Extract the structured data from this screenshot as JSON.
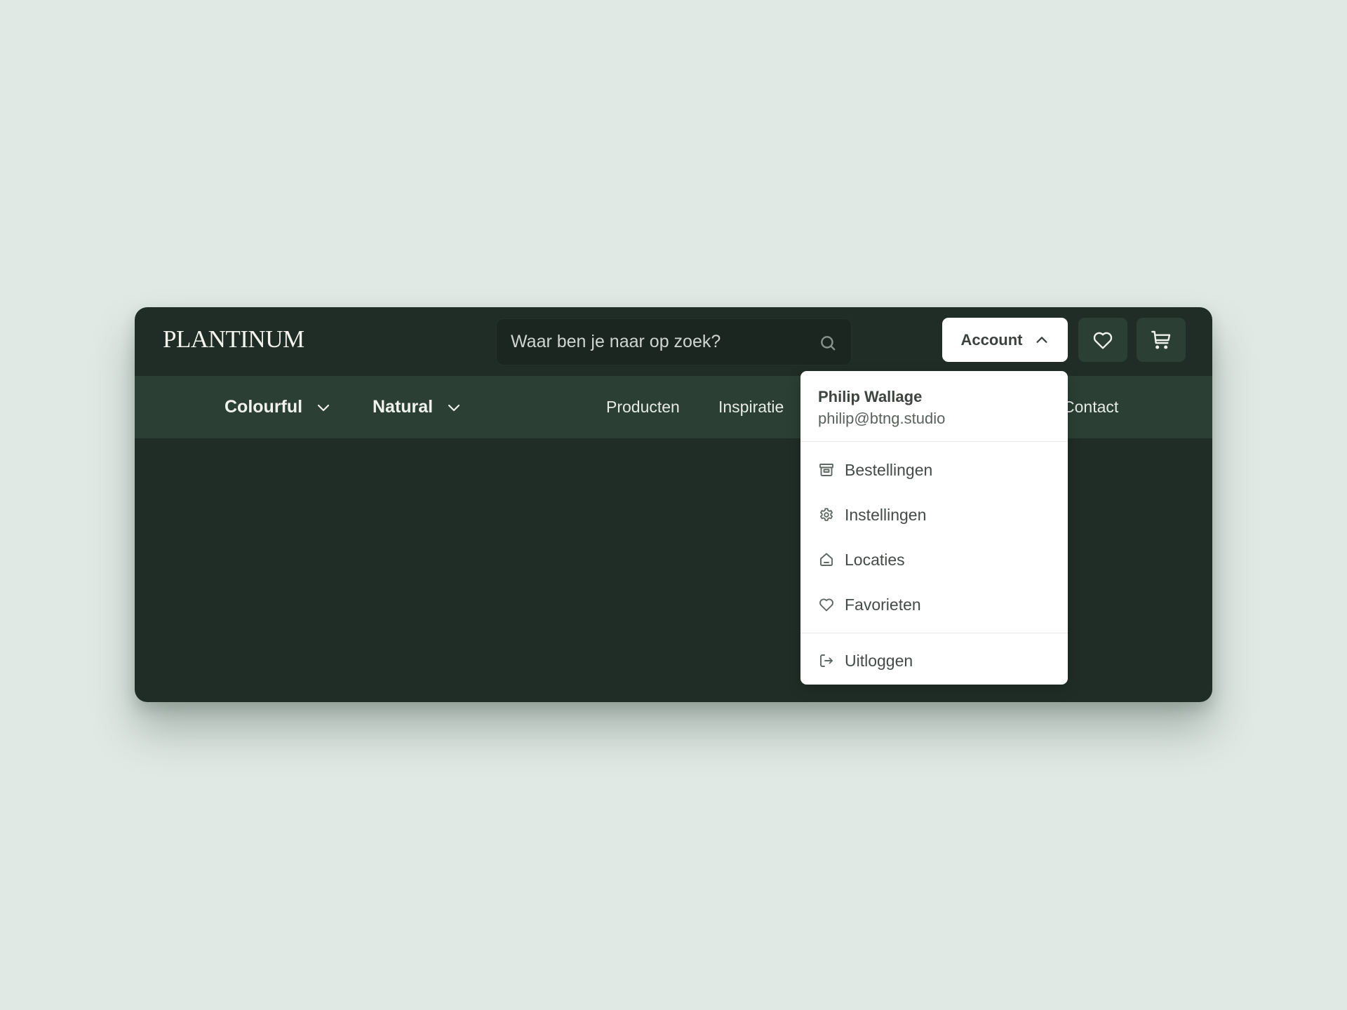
{
  "brand": {
    "logo": "PLANTINUM"
  },
  "header": {
    "search": {
      "placeholder": "Waar ben je naar op zoek?",
      "value": "",
      "icon": "search-icon"
    },
    "account_button": {
      "label": "Account",
      "icon": "chevron-up-icon",
      "expanded": true
    },
    "favorites_button": {
      "icon": "heart-icon"
    },
    "cart_button": {
      "icon": "cart-icon"
    }
  },
  "subnav": {
    "dropdown_items": [
      {
        "label": "Colourful",
        "icon": "chevron-down-icon"
      },
      {
        "label": "Natural",
        "icon": "chevron-down-icon"
      }
    ],
    "links": [
      {
        "label": "Producten"
      },
      {
        "label": "Inspiratie"
      },
      {
        "label": "Contact"
      }
    ]
  },
  "account_menu": {
    "user": {
      "name": "Philip Wallage",
      "email": "philip@btng.studio"
    },
    "items": [
      {
        "label": "Bestellingen",
        "icon": "archive-icon"
      },
      {
        "label": "Instellingen",
        "icon": "gear-icon"
      },
      {
        "label": "Locaties",
        "icon": "home-icon"
      },
      {
        "label": "Favorieten",
        "icon": "heart-icon"
      }
    ],
    "logout": {
      "label": "Uitloggen",
      "icon": "logout-icon"
    }
  },
  "colors": {
    "page_bg": "#e0e9e4",
    "header_bg": "#202d27",
    "subnav_bg": "#2b3f34",
    "icon_button_bg": "#2c3f35",
    "menu_bg": "#ffffff",
    "menu_text": "#444b47"
  }
}
